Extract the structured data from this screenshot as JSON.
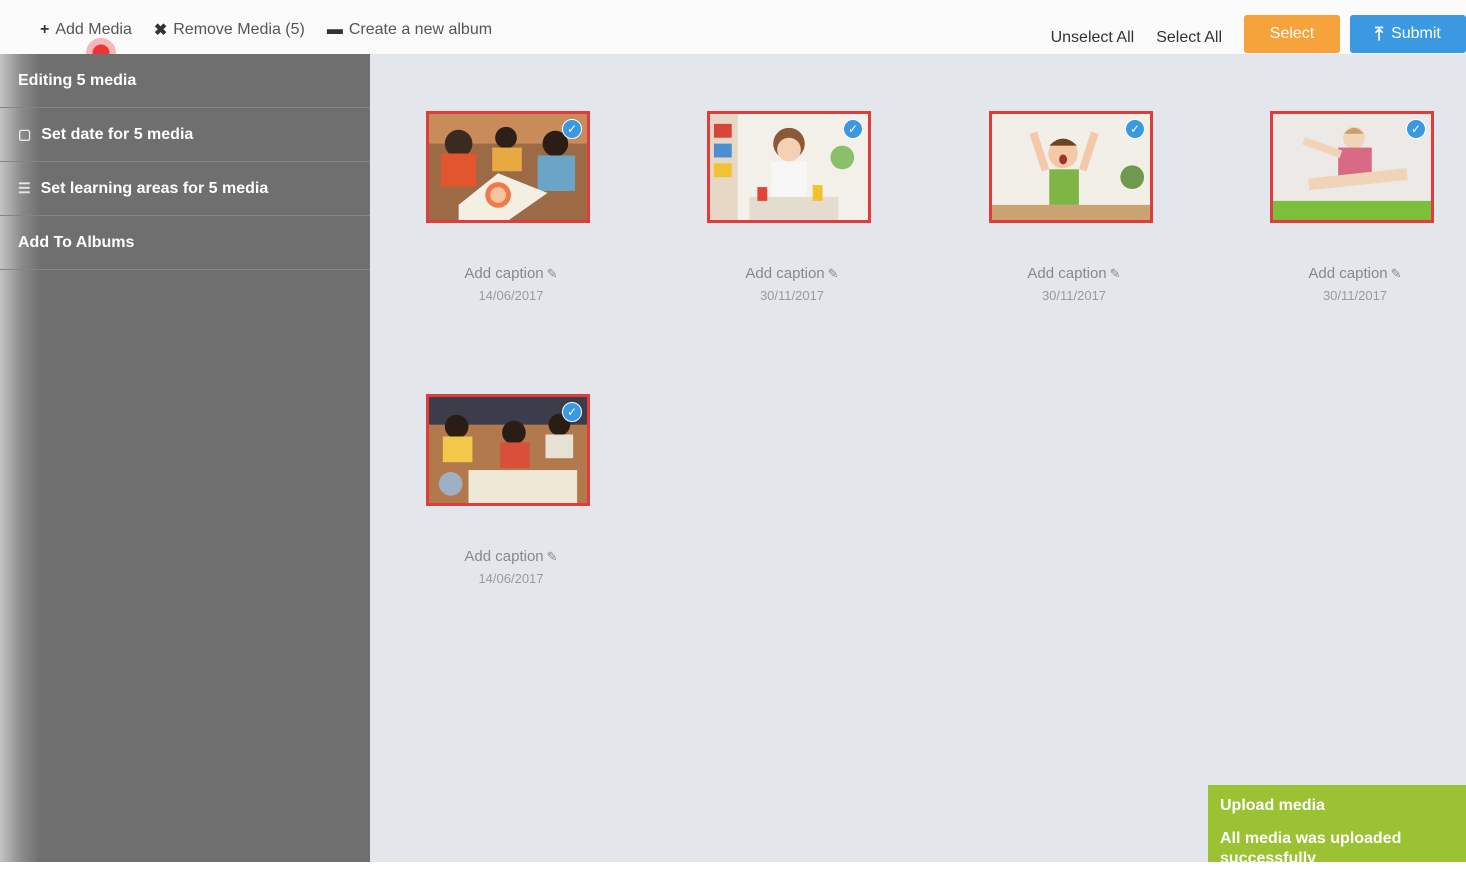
{
  "toolbar": {
    "add_media": "Add Media",
    "remove_media": "Remove Media (5)",
    "create_album": "Create a new album",
    "unselect_all": "Unselect All",
    "select_all": "Select All",
    "select_btn": "Select",
    "submit_btn": "Submit",
    "icons": {
      "add": "plus-icon",
      "remove": "x-icon",
      "album": "folder-icon",
      "submit": "upload-icon"
    }
  },
  "sidebar": {
    "header": "Editing 5 media",
    "items": [
      {
        "label": "Set date for 5 media",
        "icon": "calendar-icon"
      },
      {
        "label": "Set learning areas for 5 media",
        "icon": "list-icon"
      },
      {
        "label": "Add To Albums",
        "icon": ""
      }
    ]
  },
  "media": [
    {
      "caption": "Add caption",
      "date": "14/06/2017"
    },
    {
      "caption": "Add caption",
      "date": "30/11/2017"
    },
    {
      "caption": "Add caption",
      "date": "30/11/2017"
    },
    {
      "caption": "Add caption",
      "date": "30/11/2017"
    },
    {
      "caption": "Add caption",
      "date": "14/06/2017"
    }
  ],
  "toast": {
    "title": "Upload media",
    "message": "All media was uploaded successfully"
  },
  "colors": {
    "select": "#f5a33a",
    "submit": "#3a99e0",
    "selected_border": "#e03c3c",
    "sidebar": "#6f6f6f",
    "main_bg": "#e3e7ec",
    "toast": "#9ac233"
  }
}
